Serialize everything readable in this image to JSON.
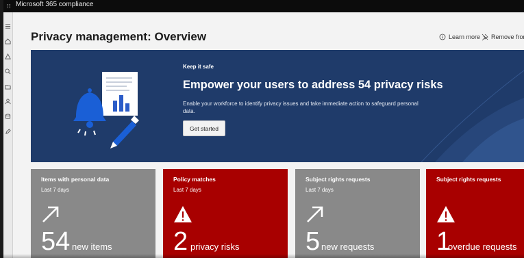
{
  "app": {
    "title": "Microsoft 365 compliance"
  },
  "rail": {
    "icons": [
      "home-icon",
      "warning-icon",
      "search-icon",
      "folder-icon",
      "users-icon",
      "database-icon",
      "edit-icon"
    ]
  },
  "page": {
    "title": "Privacy management: Overview"
  },
  "commands": {
    "learn_more": "Learn more",
    "remove": "Remove from"
  },
  "hero": {
    "kicker": "Keep it safe",
    "title": "Empower your users to address 54 privacy risks",
    "description": "Enable your workforce to identify privacy issues and take immediate action to safeguard personal data.",
    "button": "Get started"
  },
  "cards": [
    {
      "title": "Items with personal data",
      "period": "Last 7 days",
      "value": "54",
      "unit": "new items",
      "icon": "trend-up-arrow-icon",
      "color": "#898989"
    },
    {
      "title": "Policy matches",
      "period": "Last 7 days",
      "value": "2",
      "unit": "privacy risks",
      "icon": "warning-icon",
      "color": "#a80000"
    },
    {
      "title": "Subject rights requests",
      "period": "Last 7 days",
      "value": "5",
      "unit": "new requests",
      "icon": "trend-up-arrow-icon",
      "color": "#898989"
    },
    {
      "title": "Subject rights requests",
      "period": "",
      "value": "1",
      "unit": "overdue requests",
      "icon": "warning-icon",
      "color": "#a80000"
    }
  ]
}
